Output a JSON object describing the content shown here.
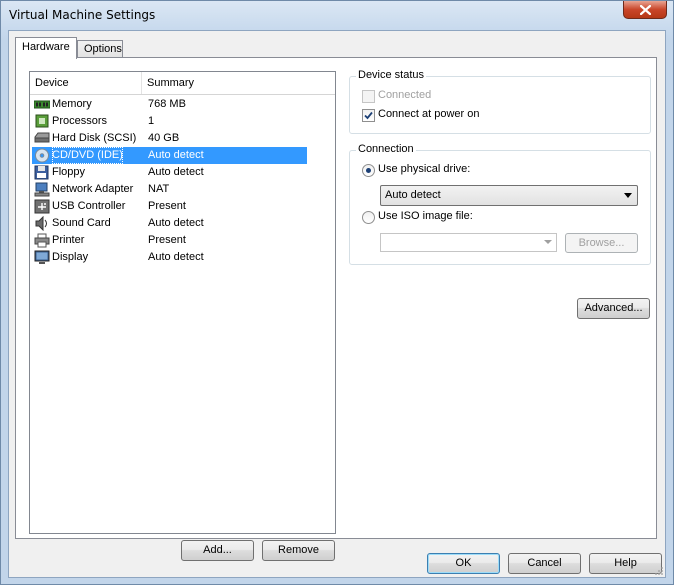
{
  "window": {
    "title": "Virtual Machine Settings"
  },
  "tabs": [
    {
      "label": "Hardware"
    },
    {
      "label": "Options"
    }
  ],
  "device_list": {
    "columns": [
      "Device",
      "Summary"
    ],
    "rows": [
      {
        "icon": "memory-icon",
        "device": "Memory",
        "summary": "768 MB"
      },
      {
        "icon": "processor-icon",
        "device": "Processors",
        "summary": "1"
      },
      {
        "icon": "hard-disk-icon",
        "device": "Hard Disk (SCSI)",
        "summary": "40 GB"
      },
      {
        "icon": "cd-dvd-icon",
        "device": "CD/DVD (IDE)",
        "summary": "Auto detect"
      },
      {
        "icon": "floppy-icon",
        "device": "Floppy",
        "summary": "Auto detect"
      },
      {
        "icon": "network-adapter-icon",
        "device": "Network Adapter",
        "summary": "NAT"
      },
      {
        "icon": "usb-icon",
        "device": "USB Controller",
        "summary": "Present"
      },
      {
        "icon": "sound-card-icon",
        "device": "Sound Card",
        "summary": "Auto detect"
      },
      {
        "icon": "printer-icon",
        "device": "Printer",
        "summary": "Present"
      },
      {
        "icon": "display-icon",
        "device": "Display",
        "summary": "Auto detect"
      }
    ],
    "selected_index": 3
  },
  "buttons": {
    "add": "Add...",
    "remove": "Remove",
    "advanced": "Advanced...",
    "browse": "Browse...",
    "ok": "OK",
    "cancel": "Cancel",
    "help": "Help"
  },
  "device_status": {
    "title": "Device status",
    "connected": {
      "label": "Connected",
      "checked": false,
      "enabled": false
    },
    "connect_at_power_on": {
      "label": "Connect at power on",
      "checked": true,
      "enabled": true
    }
  },
  "connection": {
    "title": "Connection",
    "physical": {
      "label": "Use physical drive:",
      "selected": true
    },
    "physical_drive_value": "Auto detect",
    "iso": {
      "label": "Use ISO image file:",
      "selected": false
    },
    "iso_value": ""
  },
  "colors": {
    "selection": "#3399ff",
    "title_gradient": "#c7d9ed",
    "close_button": "#c9462a"
  }
}
